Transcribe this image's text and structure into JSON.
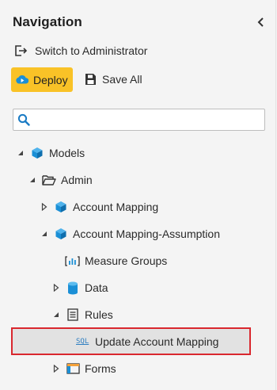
{
  "panel": {
    "title": "Navigation",
    "switch_label": "Switch to Administrator",
    "deploy_label": "Deploy",
    "save_all_label": "Save All",
    "search_placeholder": "",
    "search_value": ""
  },
  "tree": {
    "models": "Models",
    "admin": "Admin",
    "account_mapping": "Account Mapping",
    "account_mapping_assumption": "Account Mapping-Assumption",
    "measure_groups": "Measure Groups",
    "data": "Data",
    "rules": "Rules",
    "sql_tag": "SQL",
    "update_account_mapping": "Update Account Mapping",
    "forms": "Forms"
  },
  "colors": {
    "deploy_bg": "#f9c227",
    "cube_blue": "#1a8fd6",
    "selection_border": "#d9272e",
    "selection_bg": "#e2e2e2"
  },
  "icons": [
    "chevron-left-icon",
    "switch-user-icon",
    "deploy-icon",
    "save-icon",
    "search-icon",
    "cube-icon",
    "folder-open-icon",
    "measure-groups-icon",
    "database-icon",
    "rules-icon",
    "sql-icon",
    "forms-icon"
  ]
}
